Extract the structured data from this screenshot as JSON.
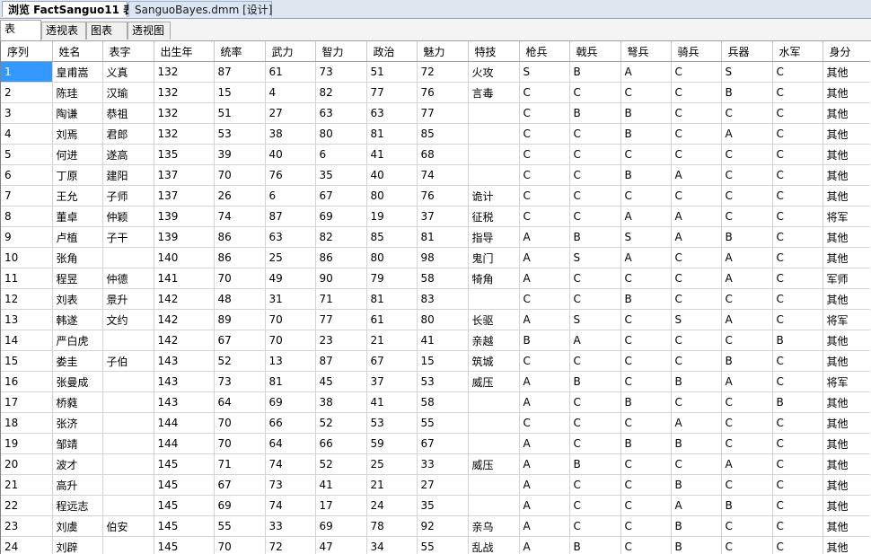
{
  "doc_tabs": [
    "浏览 FactSanguo11 表",
    "SanguoBayes.dmm [设计]"
  ],
  "view_tabs": [
    "表",
    "透视表",
    "图表",
    "透视图"
  ],
  "columns": [
    "序列",
    "姓名",
    "表字",
    "出生年",
    "统率",
    "武力",
    "智力",
    "政治",
    "魅力",
    "特技",
    "枪兵",
    "戟兵",
    "弩兵",
    "骑兵",
    "兵器",
    "水军",
    "身分"
  ],
  "selection_color": "#3399ff",
  "rows": [
    [
      "1",
      "皇甫嵩",
      "义真",
      "132",
      "87",
      "61",
      "73",
      "51",
      "72",
      "火攻",
      "S",
      "B",
      "A",
      "C",
      "S",
      "C",
      "其他"
    ],
    [
      "2",
      "陈珪",
      "汉瑜",
      "132",
      "15",
      "4",
      "82",
      "77",
      "76",
      "言毒",
      "C",
      "C",
      "C",
      "C",
      "B",
      "C",
      "其他"
    ],
    [
      "3",
      "陶谦",
      "恭祖",
      "132",
      "51",
      "27",
      "63",
      "63",
      "77",
      "",
      "C",
      "B",
      "B",
      "C",
      "C",
      "C",
      "其他"
    ],
    [
      "4",
      "刘焉",
      "君郎",
      "132",
      "53",
      "38",
      "80",
      "81",
      "85",
      "",
      "C",
      "C",
      "B",
      "C",
      "A",
      "C",
      "其他"
    ],
    [
      "5",
      "何进",
      "遂高",
      "135",
      "39",
      "40",
      "6",
      "41",
      "68",
      "",
      "C",
      "C",
      "C",
      "C",
      "C",
      "C",
      "其他"
    ],
    [
      "6",
      "丁原",
      "建阳",
      "137",
      "70",
      "76",
      "35",
      "40",
      "74",
      "",
      "C",
      "C",
      "B",
      "A",
      "C",
      "C",
      "其他"
    ],
    [
      "7",
      "王允",
      "子师",
      "137",
      "26",
      "6",
      "67",
      "80",
      "76",
      "诡计",
      "C",
      "C",
      "C",
      "C",
      "C",
      "C",
      "其他"
    ],
    [
      "8",
      "董卓",
      "仲颖",
      "139",
      "74",
      "87",
      "69",
      "19",
      "37",
      "征税",
      "C",
      "C",
      "A",
      "A",
      "C",
      "C",
      "将军"
    ],
    [
      "9",
      "卢植",
      "子干",
      "139",
      "86",
      "63",
      "82",
      "85",
      "81",
      "指导",
      "A",
      "B",
      "S",
      "A",
      "B",
      "C",
      "其他"
    ],
    [
      "10",
      "张角",
      "",
      "140",
      "86",
      "25",
      "86",
      "80",
      "98",
      "鬼门",
      "A",
      "S",
      "A",
      "C",
      "A",
      "C",
      "其他"
    ],
    [
      "11",
      "程昱",
      "仲德",
      "141",
      "70",
      "49",
      "90",
      "79",
      "58",
      "犄角",
      "A",
      "C",
      "C",
      "C",
      "A",
      "C",
      "军师"
    ],
    [
      "12",
      "刘表",
      "景升",
      "142",
      "48",
      "31",
      "71",
      "81",
      "83",
      "",
      "C",
      "C",
      "B",
      "C",
      "C",
      "C",
      "其他"
    ],
    [
      "13",
      "韩遂",
      "文约",
      "142",
      "89",
      "70",
      "77",
      "61",
      "80",
      "长驱",
      "A",
      "S",
      "C",
      "S",
      "A",
      "C",
      "将军"
    ],
    [
      "14",
      "严白虎",
      "",
      "142",
      "67",
      "70",
      "23",
      "21",
      "41",
      "亲越",
      "B",
      "A",
      "C",
      "C",
      "C",
      "B",
      "其他"
    ],
    [
      "15",
      "娄圭",
      "子伯",
      "143",
      "52",
      "13",
      "87",
      "67",
      "15",
      "筑城",
      "C",
      "C",
      "C",
      "C",
      "B",
      "C",
      "其他"
    ],
    [
      "16",
      "张曼成",
      "",
      "143",
      "73",
      "81",
      "45",
      "37",
      "53",
      "威压",
      "A",
      "B",
      "C",
      "B",
      "A",
      "C",
      "将军"
    ],
    [
      "17",
      "桥蕤",
      "",
      "143",
      "64",
      "69",
      "38",
      "41",
      "58",
      "",
      "A",
      "C",
      "B",
      "C",
      "C",
      "B",
      "其他"
    ],
    [
      "18",
      "张济",
      "",
      "144",
      "70",
      "66",
      "52",
      "53",
      "55",
      "",
      "C",
      "C",
      "C",
      "A",
      "C",
      "C",
      "其他"
    ],
    [
      "19",
      "邹靖",
      "",
      "144",
      "70",
      "64",
      "66",
      "59",
      "67",
      "",
      "A",
      "C",
      "B",
      "B",
      "C",
      "C",
      "其他"
    ],
    [
      "20",
      "波才",
      "",
      "145",
      "71",
      "74",
      "52",
      "25",
      "33",
      "威压",
      "A",
      "B",
      "C",
      "C",
      "A",
      "C",
      "其他"
    ],
    [
      "21",
      "高升",
      "",
      "145",
      "67",
      "73",
      "41",
      "21",
      "27",
      "",
      "A",
      "C",
      "C",
      "B",
      "C",
      "C",
      "其他"
    ],
    [
      "22",
      "程远志",
      "",
      "145",
      "69",
      "74",
      "17",
      "24",
      "35",
      "",
      "A",
      "C",
      "C",
      "A",
      "B",
      "C",
      "其他"
    ],
    [
      "23",
      "刘虞",
      "伯安",
      "145",
      "55",
      "33",
      "69",
      "78",
      "92",
      "亲乌",
      "A",
      "C",
      "C",
      "B",
      "C",
      "C",
      "其他"
    ],
    [
      "24",
      "刘辟",
      "",
      "145",
      "70",
      "72",
      "47",
      "34",
      "55",
      "乱战",
      "A",
      "B",
      "C",
      "B",
      "C",
      "C",
      "其他"
    ]
  ]
}
